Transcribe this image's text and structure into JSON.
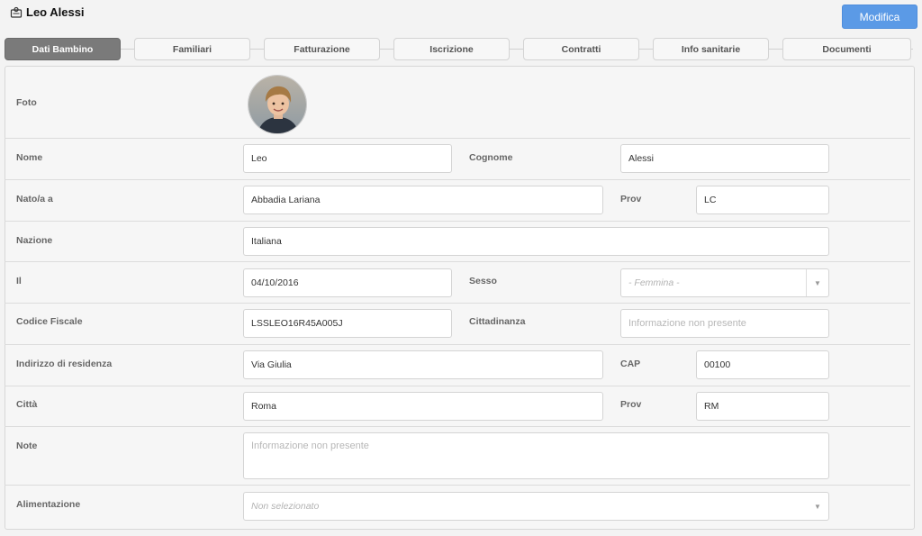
{
  "header": {
    "title": "Leo Alessi",
    "icon": "contacts-card-icon"
  },
  "toolbar": {
    "edit_label": "Modifica"
  },
  "tabs": [
    {
      "label": "Dati Bambino",
      "active": true
    },
    {
      "label": "Familiari",
      "active": false
    },
    {
      "label": "Fatturazione",
      "active": false
    },
    {
      "label": "Iscrizione",
      "active": false
    },
    {
      "label": "Contratti",
      "active": false
    },
    {
      "label": "Info sanitarie",
      "active": false
    },
    {
      "label": "Documenti",
      "active": false
    }
  ],
  "form": {
    "foto": {
      "label": "Foto"
    },
    "nome": {
      "label": "Nome",
      "value": "Leo"
    },
    "cognome": {
      "label": "Cognome",
      "value": "Alessi"
    },
    "nato": {
      "label": "Nato/a a",
      "value": "Abbadia Lariana"
    },
    "prov1": {
      "label": "Prov",
      "value": "LC"
    },
    "nazione": {
      "label": "Nazione",
      "value": "Italiana"
    },
    "il": {
      "label": "Il",
      "value": "04/10/2016"
    },
    "sesso": {
      "label": "Sesso",
      "value": "- Femmina -"
    },
    "codice_fiscale": {
      "label": "Codice Fiscale",
      "value": "LSSLEO16R45A005J"
    },
    "cittadinanza": {
      "label": "Cittadinanza",
      "placeholder": "Informazione non presente"
    },
    "indirizzo": {
      "label": "Indirizzo di residenza",
      "value": "Via Giulia"
    },
    "cap": {
      "label": "CAP",
      "value": "00100"
    },
    "citta": {
      "label": "Città",
      "value": "Roma"
    },
    "prov2": {
      "label": "Prov",
      "value": "RM"
    },
    "note": {
      "label": "Note",
      "placeholder": "Informazione non presente"
    },
    "alimentazione": {
      "label": "Alimentazione",
      "value": "Non selezionato"
    }
  },
  "colors": {
    "accent": "#5b9ae6",
    "active_tab": "#7a7a7a"
  }
}
